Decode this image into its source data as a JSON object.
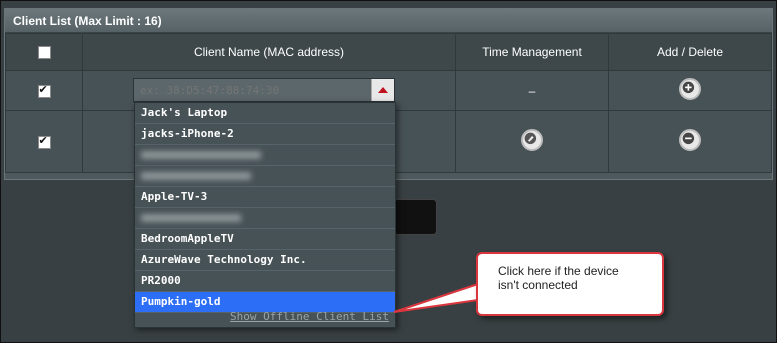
{
  "panel": {
    "title": "Client List (Max Limit : 16)"
  },
  "table": {
    "headers": {
      "name": "Client Name (MAC address)",
      "time": "Time Management",
      "add_delete": "Add / Delete"
    },
    "row1": {
      "time": "–"
    }
  },
  "mac_input": {
    "placeholder": "ex: 38:D5:47:88:74:30"
  },
  "dropdown": {
    "items": [
      "Jack's Laptop",
      "jacks-iPhone-2",
      "",
      "",
      "Apple-TV-3",
      "",
      "BedroomAppleTV",
      "AzureWave Technology Inc.",
      "PR2000",
      "Pumpkin-gold"
    ],
    "selected": "Pumpkin-gold",
    "offline_link": "Show Offline Client List"
  },
  "callout": {
    "text": "Click here if the device isn't connected"
  },
  "colors": {
    "selected": "#2d6ef7",
    "callout_border": "#d9363e",
    "arrow": "#c0111f"
  }
}
